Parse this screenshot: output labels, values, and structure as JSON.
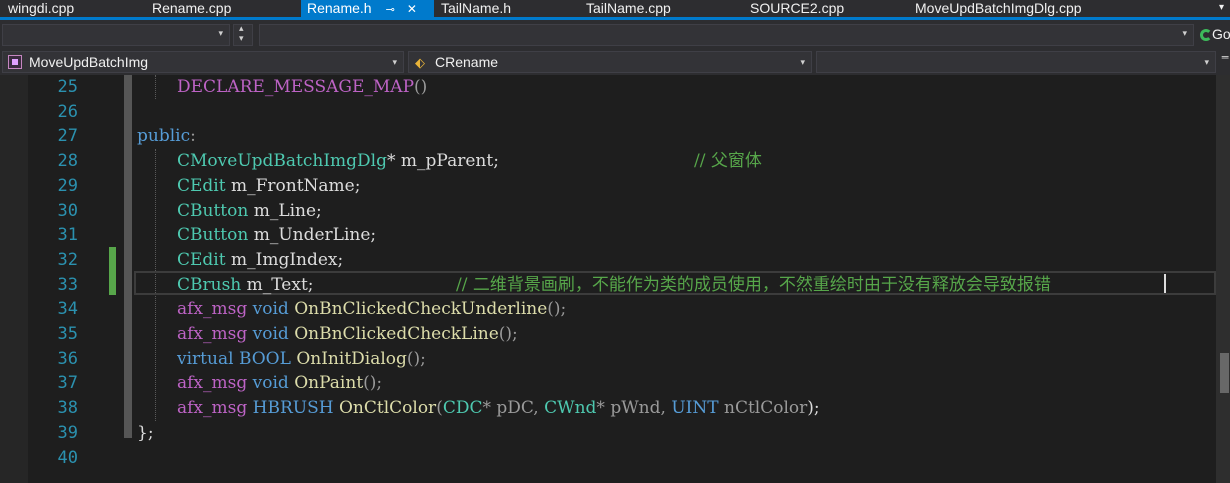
{
  "tabs": [
    {
      "label": "wingdi.cpp",
      "active": false
    },
    {
      "label": "Rename.cpp",
      "active": false
    },
    {
      "label": "Rename.h",
      "active": true
    },
    {
      "label": "TailName.h",
      "active": false
    },
    {
      "label": "TailName.cpp",
      "active": false
    },
    {
      "label": "SOURCE2.cpp",
      "active": false
    },
    {
      "label": "MoveUpdBatchImgDlg.cpp",
      "active": false
    }
  ],
  "icons": {
    "tab_pin": "⊸",
    "tab_close": "✕",
    "tab_overflow": "▾",
    "dropdown_arrow": "▾",
    "spin_up": "▴",
    "spin_down": "▾",
    "class_icon": "⬖",
    "split_handle": "═"
  },
  "toolbar": {
    "go_label": "Go"
  },
  "navigation": {
    "project": "MoveUpdBatchImg",
    "class": "CRename",
    "member": ""
  },
  "editor": {
    "line_numbers": [
      "25",
      "26",
      "27",
      "28",
      "29",
      "30",
      "31",
      "32",
      "33",
      "34",
      "35",
      "36",
      "37",
      "38",
      "39",
      "40"
    ],
    "current_line": "33",
    "changed_lines": [
      "32",
      "33"
    ]
  },
  "code": {
    "l25": {
      "text": "DECLARE_MESSAGE_MAP",
      "p": "()"
    },
    "l27": {
      "kw": "public",
      "p": ":"
    },
    "l28": {
      "type": "CMoveUpdBatchImgDlg",
      "rest": "* m_pParent;",
      "comment": "// 父窗体"
    },
    "l29": {
      "type": "CEdit",
      "rest": " m_FrontName;"
    },
    "l30": {
      "type": "CButton",
      "rest": " m_Line;"
    },
    "l31": {
      "type": "CButton",
      "rest": " m_UnderLine;"
    },
    "l32": {
      "type": "CEdit",
      "rest": " m_ImgIndex;"
    },
    "l33": {
      "type": "CBrush",
      "rest": " m_Text;",
      "comment": "// 二维背景画刷，不能作为类的成员使用，不然重绘时由于没有释放会导致报错"
    },
    "l34": {
      "pre": "afx_msg",
      "kw": "void",
      "fn": "OnBnClickedCheckUnderline",
      "p": "();"
    },
    "l35": {
      "pre": "afx_msg",
      "kw": "void",
      "fn": "OnBnClickedCheckLine",
      "p": "();"
    },
    "l36": {
      "pre": "virtual",
      "kw": "BOOL",
      "fn": "OnInitDialog",
      "p": "();"
    },
    "l37": {
      "pre": "afx_msg",
      "kw": "void",
      "fn": "OnPaint",
      "p": "();"
    },
    "l38": {
      "pre": "afx_msg",
      "kw": "HBRUSH",
      "fn": "OnCtlColor",
      "open": "(",
      "t1": "CDC",
      "a1": "* pDC, ",
      "t2": "CWnd",
      "a2": "* pWnd, ",
      "t3": "UINT",
      "a3": " nCtlColor",
      "close": ");"
    },
    "l39": {
      "p": "};"
    }
  }
}
